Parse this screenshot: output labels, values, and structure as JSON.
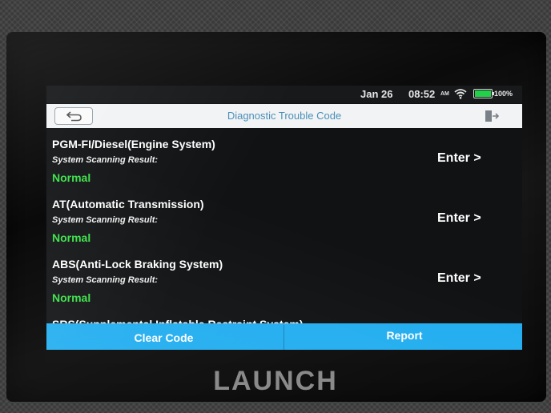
{
  "status_bar": {
    "date": "Jan 26",
    "time": "08:52",
    "ampm": "AM",
    "battery_percent": "100%",
    "battery_level": 1.0,
    "wifi_icon": "wifi-icon",
    "battery_color": "#22d04a"
  },
  "header": {
    "title": "Diagnostic Trouble Code",
    "back_icon": "back-arrow-icon",
    "exit_icon": "exit-icon"
  },
  "systems": [
    {
      "name": "PGM-FI/Diesel(Engine System)",
      "result_label": "System Scanning Result:",
      "result": "Normal",
      "action": "Enter >"
    },
    {
      "name": "AT(Automatic Transmission)",
      "result_label": "System Scanning Result:",
      "result": "Normal",
      "action": "Enter >"
    },
    {
      "name": "ABS(Anti-Lock Braking System)",
      "result_label": "System Scanning Result:",
      "result": "Normal",
      "action": "Enter >"
    }
  ],
  "partial_item": "SRS(Supplemental Inflatable Restraint System)",
  "footer": {
    "clear_label": "Clear Code",
    "report_label": "Report"
  },
  "device": {
    "brand": "LAUNCH"
  },
  "colors": {
    "accent": "#23aef0",
    "normal": "#39e046",
    "title_text": "#4a90b8"
  }
}
